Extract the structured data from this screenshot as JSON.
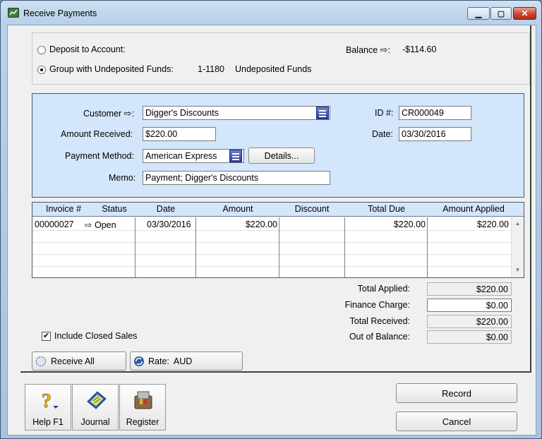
{
  "window": {
    "title": "Receive Payments"
  },
  "deposit": {
    "option1": "Deposit to Account:",
    "option2": "Group with Undeposited Funds:",
    "account_number": "1-1180",
    "account_name": "Undeposited Funds",
    "balance_label": "Balance",
    "balance_value": "-$114.60",
    "selected_option": "Group with Undeposited Funds:"
  },
  "form": {
    "customer_label": "Customer",
    "customer_value": "Digger's Discounts",
    "amount_label": "Amount Received:",
    "amount_value": "$220.00",
    "method_label": "Payment Method:",
    "method_value": "American Express",
    "details_button": "Details...",
    "memo_label": "Memo:",
    "memo_value": "Payment; Digger's Discounts",
    "id_label": "ID #:",
    "id_value": "CR000049",
    "date_label": "Date:",
    "date_value": "03/30/2016"
  },
  "grid": {
    "columns": [
      "Invoice #",
      "Status",
      "Date",
      "Amount",
      "Discount",
      "Total Due",
      "Amount Applied"
    ],
    "rows": [
      {
        "invoice": "00000027",
        "status": "Open",
        "date": "03/30/2016",
        "amount": "$220.00",
        "discount": "",
        "total_due": "$220.00",
        "applied": "$220.00"
      }
    ]
  },
  "totals": {
    "applied_label": "Total Applied:",
    "applied_value": "$220.00",
    "finance_label": "Finance Charge:",
    "finance_value": "$0.00",
    "received_label": "Total Received:",
    "received_value": "$220.00",
    "balance_label": "Out of Balance:",
    "balance_value": "$0.00"
  },
  "options": {
    "include_closed_label": "Include Closed Sales",
    "include_closed_checked": true
  },
  "actions": {
    "receive_all": "Receive All",
    "rate_label": "Rate:",
    "rate_value": "AUD",
    "help": "Help F1",
    "journal": "Journal",
    "register": "Register",
    "record": "Record",
    "cancel": "Cancel"
  },
  "colors": {
    "panel_blue": "#d3e6fb",
    "title_gradient": "#b9d1ea",
    "close_red": "#c7452d"
  }
}
